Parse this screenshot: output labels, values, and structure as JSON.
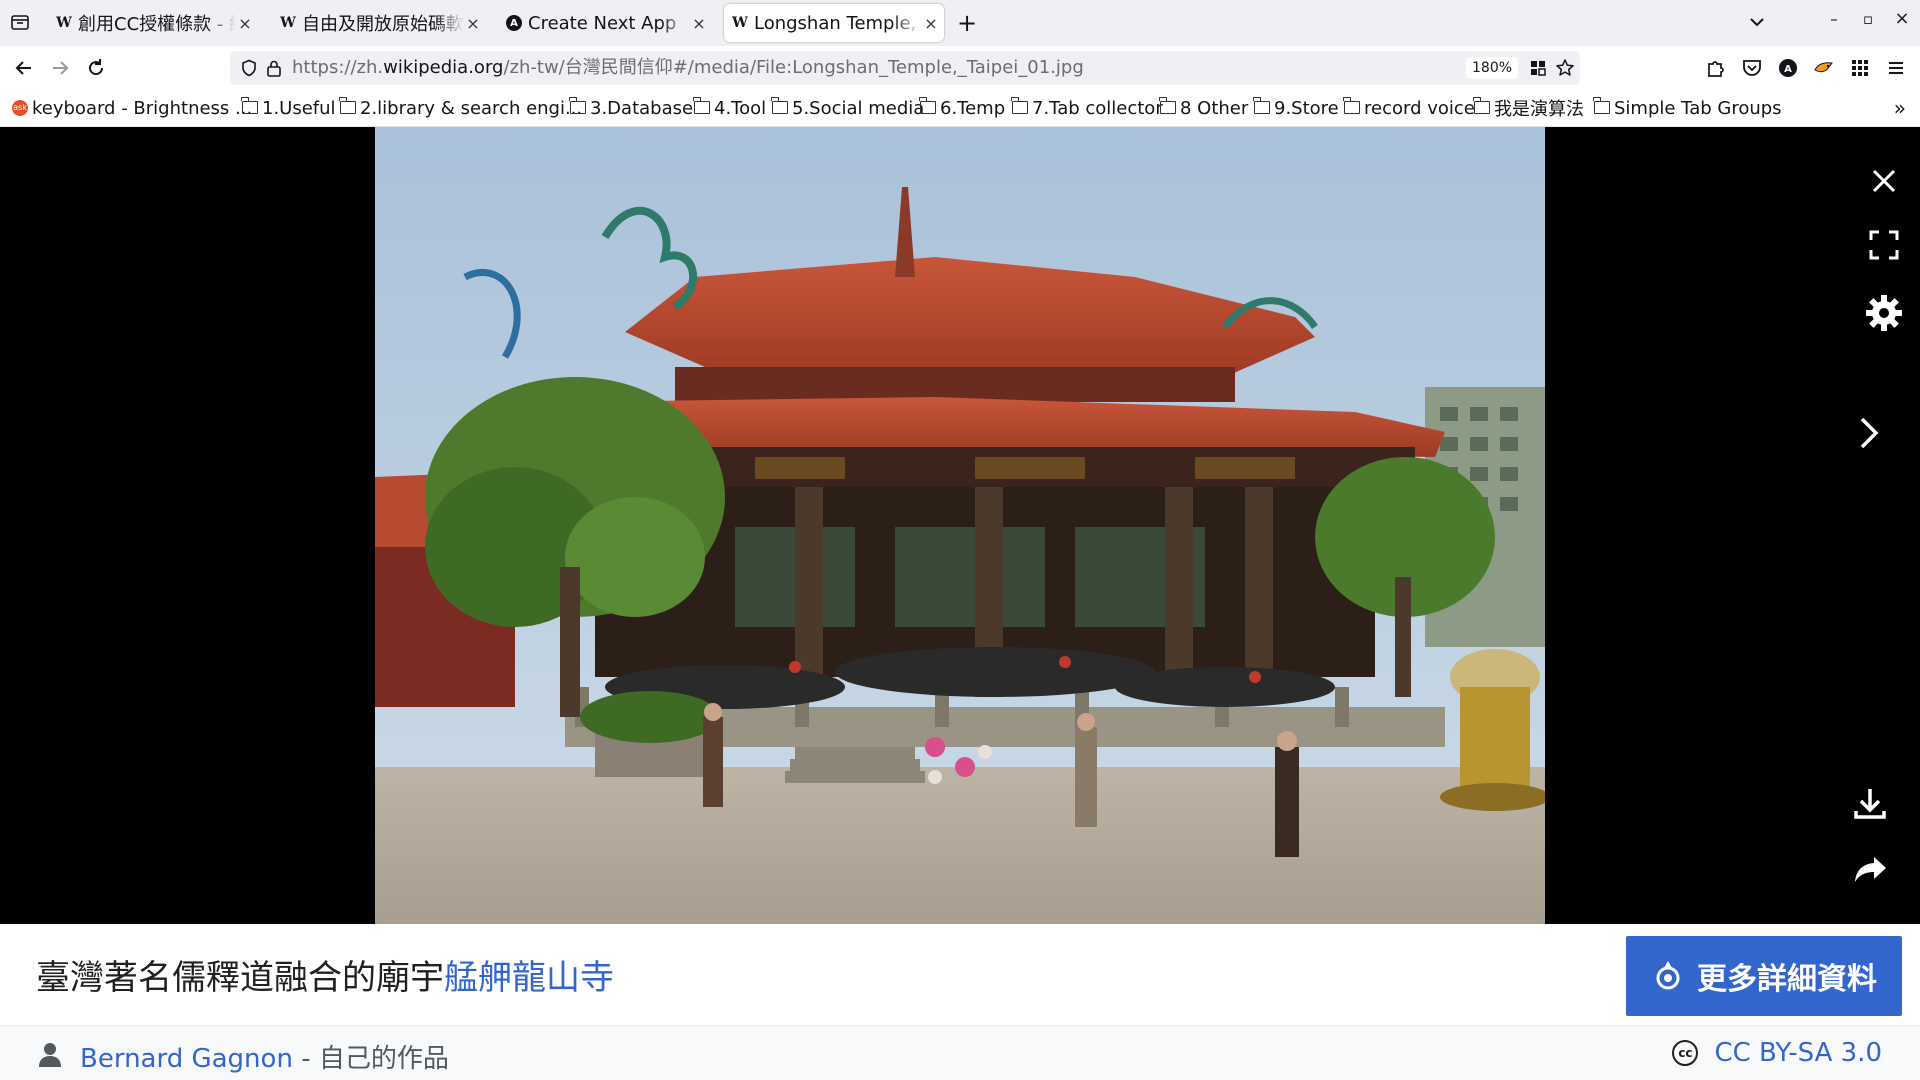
{
  "browser": {
    "tabs": [
      {
        "favicon": "W",
        "label": "創用CC授權條款 - 維基",
        "close": "×",
        "active": false
      },
      {
        "favicon": "W",
        "label": "自由及開放原始碼軟體",
        "close": "×",
        "active": false
      },
      {
        "favicon": "A",
        "label": "Create Next App",
        "close": "×",
        "active": false
      },
      {
        "favicon": "W",
        "label": "Longshan Temple, Tai",
        "close": "×",
        "active": true
      }
    ],
    "new_tab": "+",
    "window_controls": {
      "minimize": "–",
      "restore": "▫",
      "close": "×"
    },
    "url": {
      "prefix": "https://zh.",
      "domain": "wikipedia.org",
      "path": "/zh-tw/台灣民間信仰#/media/File:Longshan_Temple,_Taipei_01.jpg"
    },
    "zoom": "180%",
    "bookmarks": [
      {
        "icon": "ask-icon",
        "label": "keyboard - Brightness ..."
      },
      {
        "icon": "folder-icon",
        "label": "1.Useful"
      },
      {
        "icon": "folder-icon",
        "label": "2.library & search engi..."
      },
      {
        "icon": "folder-icon",
        "label": "3.Database"
      },
      {
        "icon": "folder-icon",
        "label": "4.Tool"
      },
      {
        "icon": "folder-icon",
        "label": "5.Social media"
      },
      {
        "icon": "folder-icon",
        "label": "6.Temp"
      },
      {
        "icon": "folder-icon",
        "label": "7.Tab collector"
      },
      {
        "icon": "folder-icon",
        "label": "8 Other"
      },
      {
        "icon": "folder-icon",
        "label": "9.Store"
      },
      {
        "icon": "folder-icon",
        "label": "record voice"
      },
      {
        "icon": "folder-icon",
        "label": "我是演算法"
      },
      {
        "icon": "folder-icon",
        "label": "Simple Tab Groups"
      }
    ],
    "bookmarks_overflow": "»"
  },
  "viewer": {
    "caption_text": "臺灣著名儒釋道融合的廟宇",
    "caption_link": "艋舺龍山寺",
    "more_details": "更多詳細資料",
    "author_name": "Bernard Gagnon",
    "author_suffix": " - 自己的作品",
    "license_icon": "cc",
    "license": "CC BY-SA 3.0"
  },
  "colors": {
    "link": "#3366cc",
    "button": "#3366cc",
    "viewer_bg": "#000000",
    "tabbar_bg": "#f0f0f4"
  }
}
